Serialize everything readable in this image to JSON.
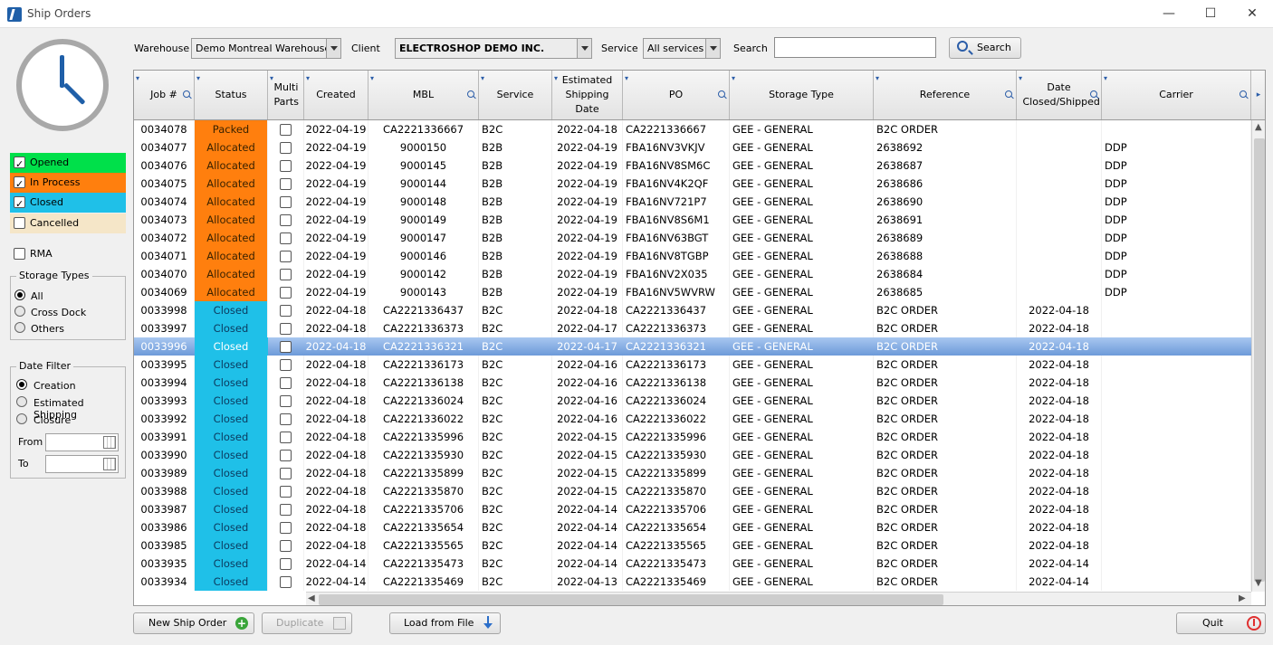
{
  "window": {
    "title": "Ship Orders",
    "minimize": "—",
    "maximize": "☐",
    "close": "✕"
  },
  "status_filters": [
    {
      "label": "Opened",
      "checked": true,
      "color": "#00e04a"
    },
    {
      "label": "In Process",
      "checked": true,
      "color": "#ff7f0e"
    },
    {
      "label": "Closed",
      "checked": true,
      "color": "#1fc0e8"
    },
    {
      "label": "Cancelled",
      "checked": false,
      "color": "#f5e6c8"
    }
  ],
  "rma": {
    "label": "RMA",
    "checked": false
  },
  "storage_types": {
    "title": "Storage Types",
    "options": [
      "All",
      "Cross Dock",
      "Others"
    ],
    "selected": "All"
  },
  "date_filter": {
    "title": "Date Filter",
    "options": [
      "Creation",
      "Estimated Shipping",
      "Closure"
    ],
    "selected": "Creation",
    "from_label": "From",
    "to_label": "To"
  },
  "filters": {
    "warehouse_label": "Warehouse",
    "warehouse_value": "Demo Montreal Warehouse",
    "client_label": "Client",
    "client_value": "ELECTROSHOP DEMO INC.",
    "service_label": "Service",
    "service_value": "All services",
    "search_label": "Search",
    "search_value": "",
    "search_button": "Search"
  },
  "columns": [
    {
      "key": "job",
      "label": "Job #",
      "search": true
    },
    {
      "key": "status",
      "label": "Status",
      "search": false
    },
    {
      "key": "multi",
      "label": "Multi Parts",
      "search": false
    },
    {
      "key": "created",
      "label": "Created",
      "search": false
    },
    {
      "key": "mbl",
      "label": "MBL",
      "search": true
    },
    {
      "key": "service",
      "label": "Service",
      "search": false
    },
    {
      "key": "est",
      "label": "Estimated Shipping Date",
      "search": false
    },
    {
      "key": "po",
      "label": "PO",
      "search": true
    },
    {
      "key": "storage",
      "label": "Storage Type",
      "search": false
    },
    {
      "key": "reference",
      "label": "Reference",
      "search": true
    },
    {
      "key": "closed",
      "label": "Date Closed/Shipped",
      "search": true
    },
    {
      "key": "carrier",
      "label": "Carrier",
      "search": true
    }
  ],
  "status_colors": {
    "Packed": "#ff7f0e",
    "Allocated": "#ff7f0e",
    "Closed": "#1fc0e8"
  },
  "selected_row": 12,
  "rows": [
    {
      "job": "0034078",
      "status": "Packed",
      "created": "2022-04-19",
      "mbl": "CA2221336667",
      "service": "B2C",
      "est": "2022-04-18",
      "po": "CA2221336667",
      "storage": "GEE - GENERAL",
      "reference": "B2C ORDER",
      "closed": "",
      "carrier": ""
    },
    {
      "job": "0034077",
      "status": "Allocated",
      "created": "2022-04-19",
      "mbl": "9000150",
      "service": "B2B",
      "est": "2022-04-19",
      "po": "FBA16NV3VKJV",
      "storage": "GEE - GENERAL",
      "reference": "2638692",
      "closed": "",
      "carrier": "DDP"
    },
    {
      "job": "0034076",
      "status": "Allocated",
      "created": "2022-04-19",
      "mbl": "9000145",
      "service": "B2B",
      "est": "2022-04-19",
      "po": "FBA16NV8SM6C",
      "storage": "GEE - GENERAL",
      "reference": "2638687",
      "closed": "",
      "carrier": "DDP"
    },
    {
      "job": "0034075",
      "status": "Allocated",
      "created": "2022-04-19",
      "mbl": "9000144",
      "service": "B2B",
      "est": "2022-04-19",
      "po": "FBA16NV4K2QF",
      "storage": "GEE - GENERAL",
      "reference": "2638686",
      "closed": "",
      "carrier": "DDP"
    },
    {
      "job": "0034074",
      "status": "Allocated",
      "created": "2022-04-19",
      "mbl": "9000148",
      "service": "B2B",
      "est": "2022-04-19",
      "po": "FBA16NV721P7",
      "storage": "GEE - GENERAL",
      "reference": "2638690",
      "closed": "",
      "carrier": "DDP"
    },
    {
      "job": "0034073",
      "status": "Allocated",
      "created": "2022-04-19",
      "mbl": "9000149",
      "service": "B2B",
      "est": "2022-04-19",
      "po": "FBA16NV8S6M1",
      "storage": "GEE - GENERAL",
      "reference": "2638691",
      "closed": "",
      "carrier": "DDP"
    },
    {
      "job": "0034072",
      "status": "Allocated",
      "created": "2022-04-19",
      "mbl": "9000147",
      "service": "B2B",
      "est": "2022-04-19",
      "po": "FBA16NV63BGT",
      "storage": "GEE - GENERAL",
      "reference": "2638689",
      "closed": "",
      "carrier": "DDP"
    },
    {
      "job": "0034071",
      "status": "Allocated",
      "created": "2022-04-19",
      "mbl": "9000146",
      "service": "B2B",
      "est": "2022-04-19",
      "po": "FBA16NV8TGBP",
      "storage": "GEE - GENERAL",
      "reference": "2638688",
      "closed": "",
      "carrier": "DDP"
    },
    {
      "job": "0034070",
      "status": "Allocated",
      "created": "2022-04-19",
      "mbl": "9000142",
      "service": "B2B",
      "est": "2022-04-19",
      "po": "FBA16NV2X035",
      "storage": "GEE - GENERAL",
      "reference": "2638684",
      "closed": "",
      "carrier": "DDP"
    },
    {
      "job": "0034069",
      "status": "Allocated",
      "created": "2022-04-19",
      "mbl": "9000143",
      "service": "B2B",
      "est": "2022-04-19",
      "po": "FBA16NV5WVRW",
      "storage": "GEE - GENERAL",
      "reference": "2638685",
      "closed": "",
      "carrier": "DDP"
    },
    {
      "job": "0033998",
      "status": "Closed",
      "created": "2022-04-18",
      "mbl": "CA2221336437",
      "service": "B2C",
      "est": "2022-04-18",
      "po": "CA2221336437",
      "storage": "GEE - GENERAL",
      "reference": "B2C ORDER",
      "closed": "2022-04-18",
      "carrier": ""
    },
    {
      "job": "0033997",
      "status": "Closed",
      "created": "2022-04-18",
      "mbl": "CA2221336373",
      "service": "B2C",
      "est": "2022-04-17",
      "po": "CA2221336373",
      "storage": "GEE - GENERAL",
      "reference": "B2C ORDER",
      "closed": "2022-04-18",
      "carrier": ""
    },
    {
      "job": "0033996",
      "status": "Closed",
      "created": "2022-04-18",
      "mbl": "CA2221336321",
      "service": "B2C",
      "est": "2022-04-17",
      "po": "CA2221336321",
      "storage": "GEE - GENERAL",
      "reference": "B2C ORDER",
      "closed": "2022-04-18",
      "carrier": ""
    },
    {
      "job": "0033995",
      "status": "Closed",
      "created": "2022-04-18",
      "mbl": "CA2221336173",
      "service": "B2C",
      "est": "2022-04-16",
      "po": "CA2221336173",
      "storage": "GEE - GENERAL",
      "reference": "B2C ORDER",
      "closed": "2022-04-18",
      "carrier": ""
    },
    {
      "job": "0033994",
      "status": "Closed",
      "created": "2022-04-18",
      "mbl": "CA2221336138",
      "service": "B2C",
      "est": "2022-04-16",
      "po": "CA2221336138",
      "storage": "GEE - GENERAL",
      "reference": "B2C ORDER",
      "closed": "2022-04-18",
      "carrier": ""
    },
    {
      "job": "0033993",
      "status": "Closed",
      "created": "2022-04-18",
      "mbl": "CA2221336024",
      "service": "B2C",
      "est": "2022-04-16",
      "po": "CA2221336024",
      "storage": "GEE - GENERAL",
      "reference": "B2C ORDER",
      "closed": "2022-04-18",
      "carrier": ""
    },
    {
      "job": "0033992",
      "status": "Closed",
      "created": "2022-04-18",
      "mbl": "CA2221336022",
      "service": "B2C",
      "est": "2022-04-16",
      "po": "CA2221336022",
      "storage": "GEE - GENERAL",
      "reference": "B2C ORDER",
      "closed": "2022-04-18",
      "carrier": ""
    },
    {
      "job": "0033991",
      "status": "Closed",
      "created": "2022-04-18",
      "mbl": "CA2221335996",
      "service": "B2C",
      "est": "2022-04-15",
      "po": "CA2221335996",
      "storage": "GEE - GENERAL",
      "reference": "B2C ORDER",
      "closed": "2022-04-18",
      "carrier": ""
    },
    {
      "job": "0033990",
      "status": "Closed",
      "created": "2022-04-18",
      "mbl": "CA2221335930",
      "service": "B2C",
      "est": "2022-04-15",
      "po": "CA2221335930",
      "storage": "GEE - GENERAL",
      "reference": "B2C ORDER",
      "closed": "2022-04-18",
      "carrier": ""
    },
    {
      "job": "0033989",
      "status": "Closed",
      "created": "2022-04-18",
      "mbl": "CA2221335899",
      "service": "B2C",
      "est": "2022-04-15",
      "po": "CA2221335899",
      "storage": "GEE - GENERAL",
      "reference": "B2C ORDER",
      "closed": "2022-04-18",
      "carrier": ""
    },
    {
      "job": "0033988",
      "status": "Closed",
      "created": "2022-04-18",
      "mbl": "CA2221335870",
      "service": "B2C",
      "est": "2022-04-15",
      "po": "CA2221335870",
      "storage": "GEE - GENERAL",
      "reference": "B2C ORDER",
      "closed": "2022-04-18",
      "carrier": ""
    },
    {
      "job": "0033987",
      "status": "Closed",
      "created": "2022-04-18",
      "mbl": "CA2221335706",
      "service": "B2C",
      "est": "2022-04-14",
      "po": "CA2221335706",
      "storage": "GEE - GENERAL",
      "reference": "B2C ORDER",
      "closed": "2022-04-18",
      "carrier": ""
    },
    {
      "job": "0033986",
      "status": "Closed",
      "created": "2022-04-18",
      "mbl": "CA2221335654",
      "service": "B2C",
      "est": "2022-04-14",
      "po": "CA2221335654",
      "storage": "GEE - GENERAL",
      "reference": "B2C ORDER",
      "closed": "2022-04-18",
      "carrier": ""
    },
    {
      "job": "0033985",
      "status": "Closed",
      "created": "2022-04-18",
      "mbl": "CA2221335565",
      "service": "B2C",
      "est": "2022-04-14",
      "po": "CA2221335565",
      "storage": "GEE - GENERAL",
      "reference": "B2C ORDER",
      "closed": "2022-04-18",
      "carrier": ""
    },
    {
      "job": "0033935",
      "status": "Closed",
      "created": "2022-04-14",
      "mbl": "CA2221335473",
      "service": "B2C",
      "est": "2022-04-14",
      "po": "CA2221335473",
      "storage": "GEE - GENERAL",
      "reference": "B2C ORDER",
      "closed": "2022-04-14",
      "carrier": ""
    },
    {
      "job": "0033934",
      "status": "Closed",
      "created": "2022-04-14",
      "mbl": "CA2221335469",
      "service": "B2C",
      "est": "2022-04-13",
      "po": "CA2221335469",
      "storage": "GEE - GENERAL",
      "reference": "B2C ORDER",
      "closed": "2022-04-14",
      "carrier": ""
    }
  ],
  "buttons": {
    "new_order": "New Ship Order",
    "duplicate": "Duplicate",
    "load_file": "Load from File",
    "quit": "Quit"
  },
  "icons": {
    "clock": "clock-icon",
    "search": "magnifier-icon",
    "add": "plus-circle-icon",
    "duplicate": "copy-icon",
    "load": "download-arrow-icon",
    "quit": "power-icon"
  }
}
